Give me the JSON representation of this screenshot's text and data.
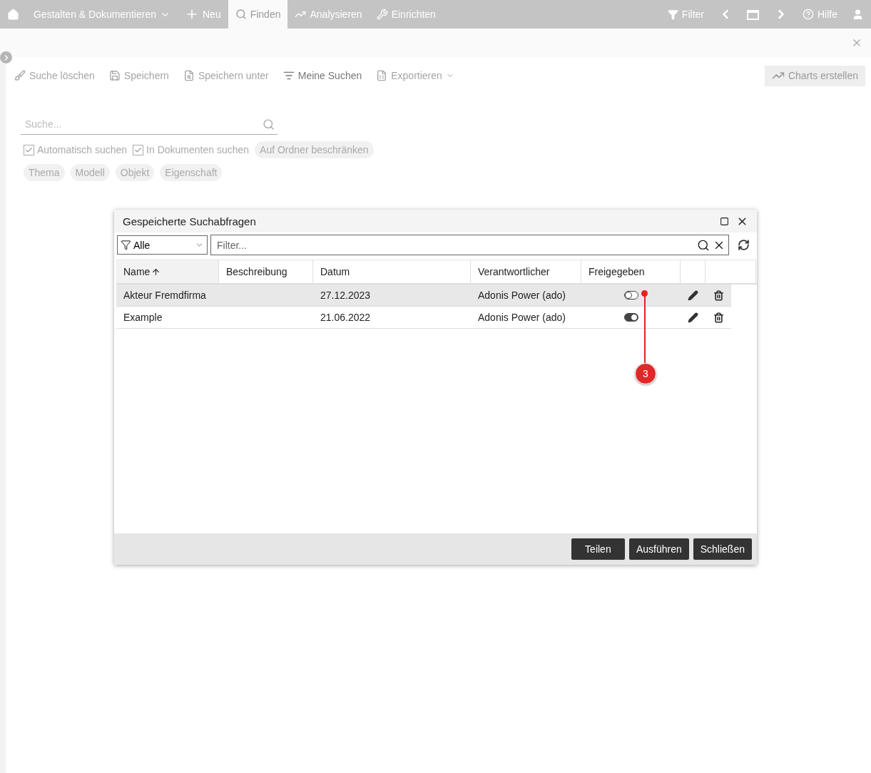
{
  "nav": {
    "left": [
      {
        "label": "Gestalten & Dokumentieren",
        "selected": false
      },
      {
        "label": "Neu",
        "selected": false
      },
      {
        "label": "Finden",
        "selected": true
      },
      {
        "label": "Analysieren",
        "selected": false
      },
      {
        "label": "Einrichten",
        "selected": false
      }
    ],
    "right": [
      {
        "label": "Filter"
      },
      {
        "label": "Hilfe"
      }
    ]
  },
  "toolbar": [
    {
      "label": "Suche löschen",
      "disabled": true
    },
    {
      "label": "Speichern",
      "disabled": true
    },
    {
      "label": "Speichern unter",
      "disabled": true
    },
    {
      "label": "Meine Suchen",
      "disabled": false
    },
    {
      "label": "Exportieren",
      "disabled": true
    }
  ],
  "charts_button": {
    "label": "Charts erstellen",
    "disabled": true
  },
  "search": {
    "placeholder": "Suche..."
  },
  "options": [
    {
      "label": "Automatisch suchen",
      "checked": true
    },
    {
      "label": "In Dokumenten suchen",
      "checked": true
    }
  ],
  "folder_chip": "Auf Ordner beschränken",
  "chips": [
    "Thema",
    "Modell",
    "Objekt",
    "Eigenschaft"
  ],
  "dialog": {
    "title": "Gespeicherte Suchabfragen",
    "select": "Alle",
    "filter": {
      "placeholder": "Filter..."
    },
    "columns": [
      {
        "label": "Name",
        "sorted": true
      },
      {
        "label": "Beschreibung",
        "sorted": false
      },
      {
        "label": "Datum",
        "sorted": false
      },
      {
        "label": "Verantwortlicher",
        "sorted": false
      },
      {
        "label": "Freigegeben",
        "sorted": false
      }
    ],
    "rows": [
      {
        "name": "Akteur Fremdfirma",
        "date": "27.12.2023",
        "owner": "Adonis Power (ado)",
        "shared": false,
        "selected": true
      },
      {
        "name": "Example",
        "date": "21.06.2022",
        "owner": "Adonis Power (ado)",
        "shared": true,
        "selected": false
      }
    ],
    "buttons": [
      "Teilen",
      "Ausführen",
      "Schließen"
    ]
  },
  "annotation": {
    "label": "3"
  }
}
